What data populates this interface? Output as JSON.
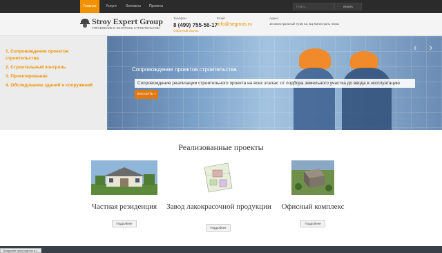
{
  "nav": {
    "items": [
      "Главная",
      "Услуги",
      "Контакты",
      "Проекты"
    ],
    "search_placeholder": "Поиск...",
    "search_button": "искать"
  },
  "header": {
    "logo_title": "Stroy Expert Group",
    "logo_subtitle": "УПРАВЛЕНИЕ И КОНТРОЛЬ СТРОИТЕЛЬСТВА",
    "phone_label": "Телефон:",
    "phone": "8 (499) 755-56-17",
    "callback": "Обратный звонок",
    "email_label": "Email:",
    "email": "info@segmos.ru",
    "address_label": "Адрес:",
    "address": "16-магистральный тупик 5а, БЦ Магистраль плаза"
  },
  "sidebar": {
    "items": [
      "1. Сопровождение проектов строительства",
      "2. Строительный контроль",
      "3. Проектирование",
      "4. Обследование зданий и сооружений"
    ]
  },
  "slider": {
    "title": "Сопровождение проектов строительства",
    "caption": "Сопровождение реализации строительного проекта на всех этапах: от подбора земельного участка до ввода в эксплуатацию",
    "button": "ЗАКАЗАТЬ »",
    "prev": "‹",
    "next": "›"
  },
  "projects": {
    "title": "Реализованные проекты",
    "items": [
      {
        "name": "Частная резиденция",
        "button": "Подробнее"
      },
      {
        "name": "Завод лакокрасочной продукции",
        "button": "Подробнее"
      },
      {
        "name": "Офисный комплекс",
        "button": "Подробнее"
      }
    ]
  },
  "status_url": "Ожидание www.segmos.ru..."
}
